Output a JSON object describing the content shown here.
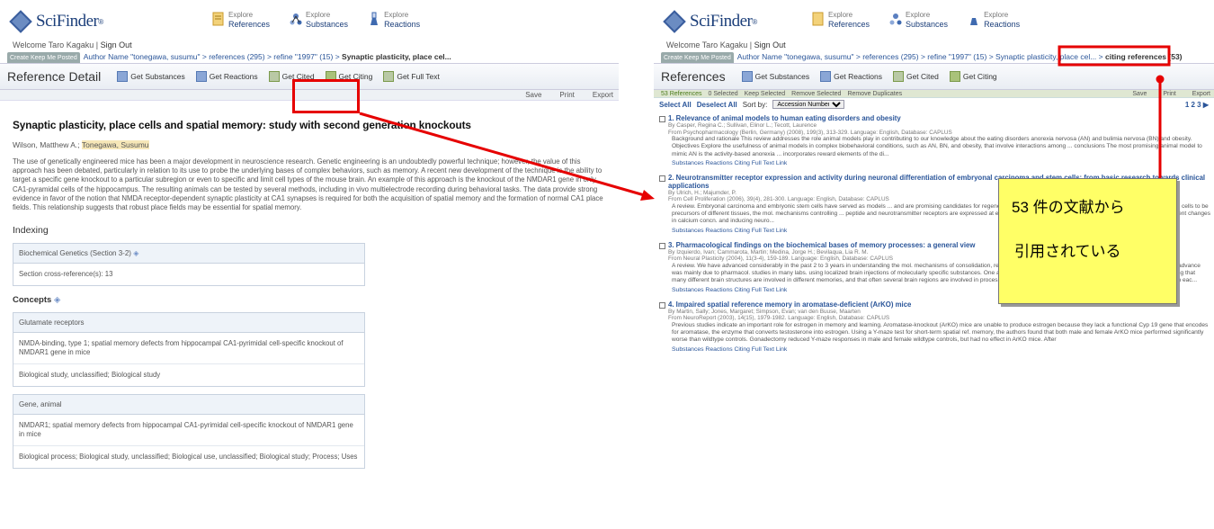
{
  "left": {
    "logo": "SciFinder",
    "nav": [
      {
        "small": "Explore",
        "label": "References",
        "color": "#e6b34a"
      },
      {
        "small": "Explore",
        "label": "Substances",
        "color": "#5a7fc0"
      },
      {
        "small": "Explore",
        "label": "Reactions",
        "color": "#3f6ab0"
      }
    ],
    "welcome": "Welcome Taro Kagaku",
    "signout": "Sign Out",
    "crumb": {
      "btn": "Create Keep Me Posted",
      "path": "Author Name \"tonegawa, susumu\" > references (295) > refine \"1997\" (15) >",
      "current": "Synaptic plasticity, place cel..."
    },
    "toolbar": {
      "title": "Reference Detail",
      "items": [
        "Get Substances",
        "Get Reactions",
        "Get Cited",
        "Get Citing",
        "Get Full Text"
      ]
    },
    "sub": [
      "Save",
      "Print",
      "Export"
    ],
    "title": "Synaptic plasticity, place cells and spatial memory: study with second generation knockouts",
    "authors_plain": "Wilson, Matthew A.;",
    "authors_hl": "Tonegawa, Susumu",
    "abstract": "The use of genetically engineered mice has been a major development in neuroscience research. Genetic engineering is an undoubtedly powerful technique; however, the value of this approach has been debated, particularly in relation to its use to probe the underlying bases of complex behaviors, such as memory. A recent new development of the technique is the ability to target a specific gene knockout to a particular subregion or even to specific and limit cell types of the mouse brain. An example of this approach is the knockout of the NMDAR1 gene in only CA1-pyramidal cells of the hippocampus. The resulting animals can be tested by several methods, including in vivo multielectrode recording during behavioral tasks. The data provide strong evidence in favor of the notion that NMDA receptor-dependent synaptic plasticity at CA1 synapses is required for both the acquisition of spatial memory and the formation of normal CA1 place fields. This relationship suggests that robust place fields may be essential for spatial memory.",
    "indexing": "Indexing",
    "section": "Biochemical Genetics (Section 3-2)",
    "crossref": "Section cross-reference(s): 13",
    "concepts": "Concepts",
    "concept1": {
      "head": "Glutamate receptors",
      "body1": "NMDA-binding, type 1; spatial memory defects from hippocampal CA1-pyrimidal cell-specific knockout of NMDAR1 gene in mice",
      "body2": "Biological study, unclassified; Biological study"
    },
    "concept2": {
      "head": "Gene, animal",
      "body1": "NMDAR1; spatial memory defects from hippocampal CA1-pyrimidal cell-specific knockout of NMDAR1 gene in mice",
      "body2": "Biological process; Biological study, unclassified; Biological use, unclassified; Biological study; Process; Uses"
    }
  },
  "right": {
    "logo": "SciFinder",
    "welcome": "Welcome Taro Kagaku",
    "signout": "Sign Out",
    "crumb": {
      "btn": "Create Keep Me Posted",
      "path": "Author Name \"tonegawa, susumu\" > references (295) > refine \"1997\" (15) > Synaptic plasticity, place cel... >",
      "current": "citing references (53)"
    },
    "toolbar": {
      "title": "References",
      "items": [
        "Get Substances",
        "Get Reactions",
        "Get Cited",
        "Get Citing"
      ]
    },
    "bar": {
      "count": "53 References",
      "items": [
        "0 Selected",
        "Keep Selected",
        "Remove Selected",
        "Remove Duplicates"
      ],
      "right": [
        "Save",
        "Print",
        "Export"
      ]
    },
    "sel": {
      "all": "Select All",
      "none": "Deselect All",
      "sort": "Sort by:",
      "option": "Accession Number",
      "pages": "1 2 3"
    },
    "results": [
      {
        "t": "1. Relevance of animal models to human eating disorders and obesity",
        "by": "By Casper, Regina C.; Sullivan, Elinor L.; Tecott, Laurence",
        "from": "From Psychopharmacology (Berlin, Germany) (2008), 199(3), 313-329. Language: English, Database: CAPLUS",
        "a": "Background and rationale This review addresses the role animal models play in contributing to our knowledge about the eating disorders anorexia nervosa (AN) and bulimia nervosa (BN) and obesity. Objectives Explore the usefulness of animal models in complex biobehavioral conditions, such as AN, BN, and obesity, that involve interactions among ... conclusions The most promising animal model to mimic AN is the activity-based anorexia ... incorporates reward elements of the di..."
      },
      {
        "t": "2. Neurotransmitter receptor expression and activity during neuronal differentiation of embryonal carcinoma and stem cells: from basic research towards clinical applications",
        "by": "By Ulrich, H.; Majumder, P.",
        "from": "From Cell Proliferation (2006), 39(4), 281-300. Language: English, Database: CAPLUS",
        "a": "A review. Embryonal carcinoma and embryonic stem cells have served as models ... and are promising candidates for regenerative medicine. Besides being well characterized ... embryonic stem cells to be precursors of different tissues, the mol. mechanisms controlling ... peptide and neurotransmitter receptors are expressed at early stages of differentiation prior to synaptogenesis, triggering transient changes in calcium concn. and inducing neuro..."
      },
      {
        "t": "3. Pharmacological findings on the biochemical bases of memory processes: a general view",
        "by": "By Izquierdo, Ivan; Cammarota, Martin; Medina, Jorge H.; Bevilaqua, Lia R. M.",
        "from": "From Neural Plasticity (2004), 11(3-4), 159-189. Language: English, Database: CAPLUS",
        "a": "A review. We have advanced considerably in the past 2 to 3 years in understanding the mol. mechanisms of consolidation, retrieval, and extinction of memories, particularly of fear memory. This advance was mainly due to pharmacol. studies in many labs. using localized brain injections of molecularly specific substances. One area in which significant advances have been made is in understanding that many different brain structures are involved in different memories, and that often several brain regions are involved in processing the same memory. These regions can cooperate or compete with eac..."
      },
      {
        "t": "4. Impaired spatial reference memory in aromatase-deficient (ArKO) mice",
        "by": "By Martin, Sally; Jones, Margaret; Simpson, Evan; van den Buuse, Maarten",
        "from": "From NeuroReport (2003), 14(15), 1979-1982. Language: English, Database: CAPLUS",
        "a": "Previous studies indicate an important role for estrogen in memory and learning. Aromatase-knockout (ArKO) mice are unable to produce estrogen because they lack a functional Cyp 19 gene that encodes for aromatase, the enzyme that converts testosterone into estrogen. Using a Y-maze test for short-term spatial ref. memory, the authors found that both male and female ArKO mice performed significantly worse than wildtype controls. Gonadectomy reduced Y-maze responses in male and female wildtype controls, but had no effect in ArKO mice. After"
      }
    ],
    "links": "Substances  Reactions  Citing  Full Text  Link"
  },
  "callout": {
    "line1": "53 件の文献から",
    "line2": "引用されている"
  },
  "colors": {
    "highlight": "#e60000",
    "callout_bg": "#ffff66",
    "link": "#2a5599"
  }
}
